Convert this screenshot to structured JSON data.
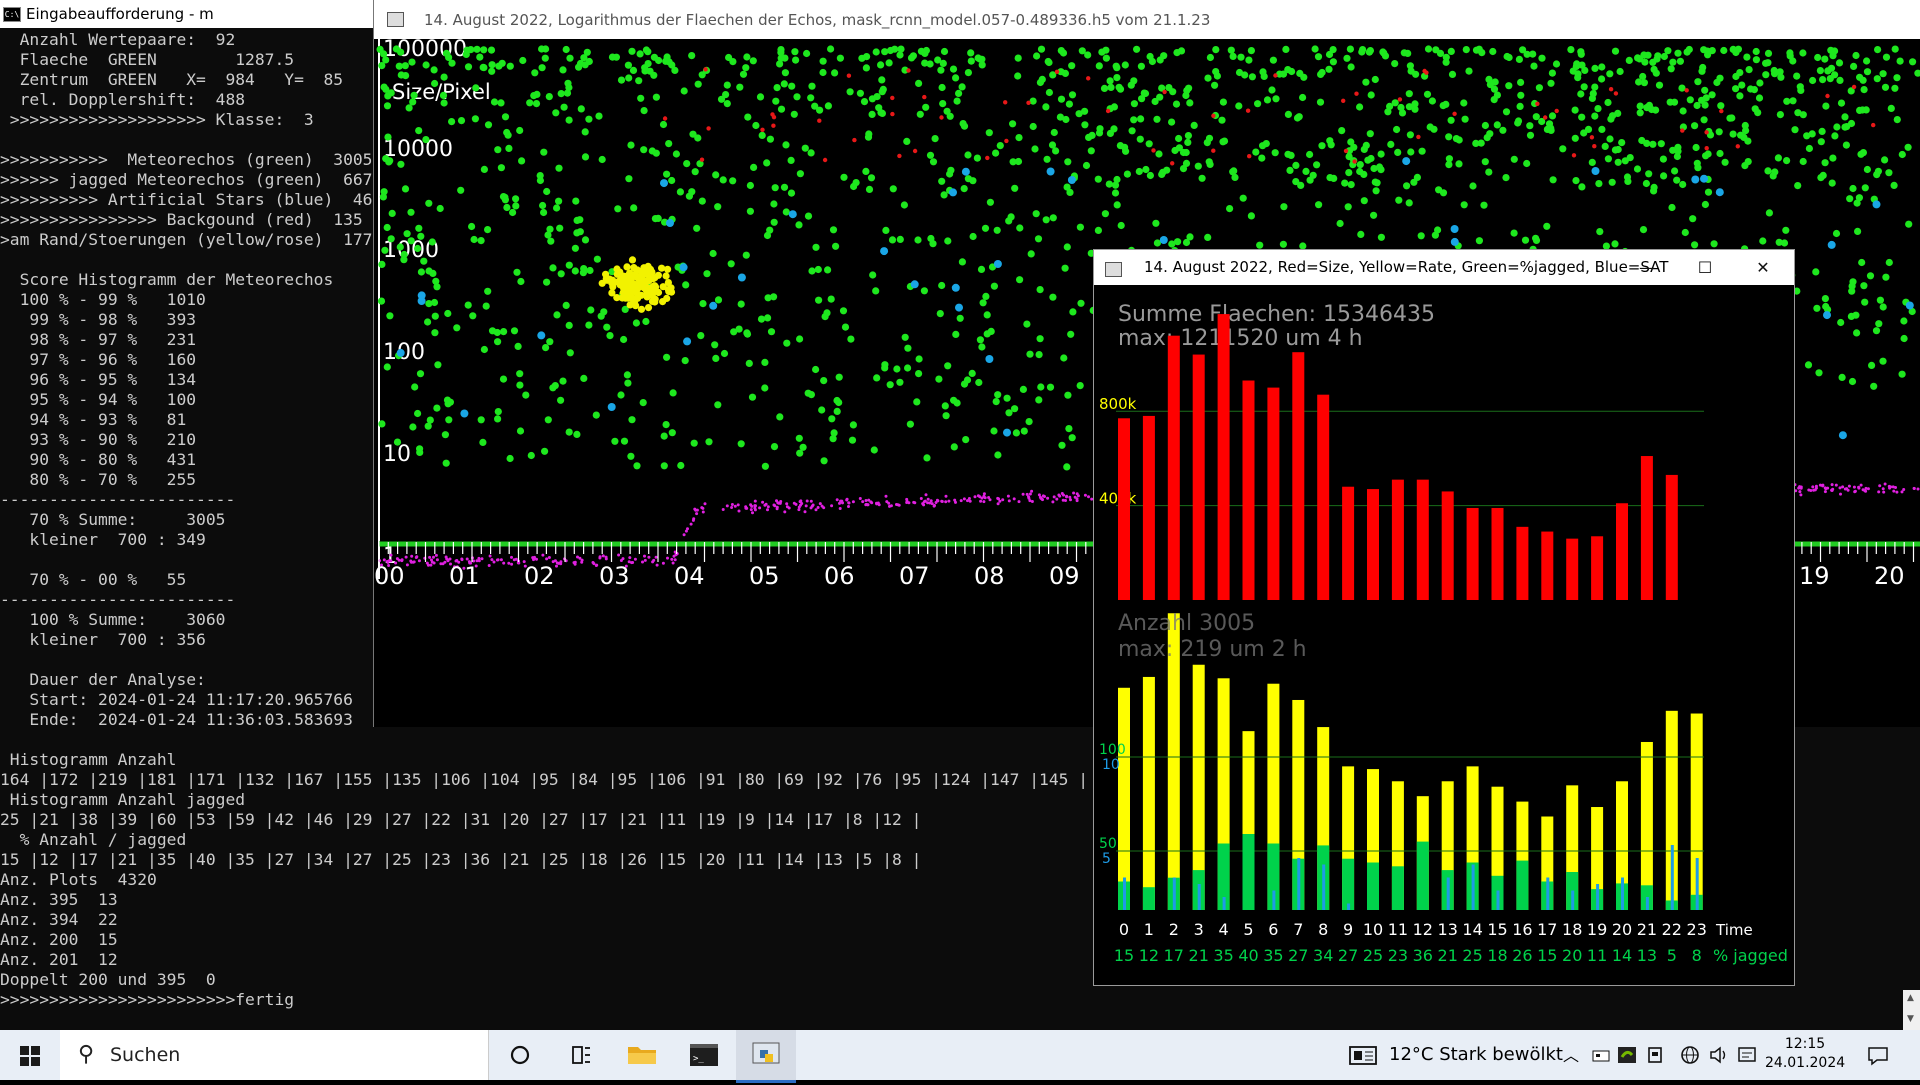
{
  "console": {
    "title": "Eingabeaufforderung - m",
    "lines": [
      "  Anzahl Wertepaare:  92",
      "  Flaeche  GREEN        1287.5",
      "  Zentrum  GREEN   X=  984   Y=  85",
      "  rel. Dopplershift:  488",
      " >>>>>>>>>>>>>>>>>>>> Klasse:  3",
      "",
      ">>>>>>>>>>>  Meteorechos (green)  3005",
      ">>>>>> jagged Meteorechos (green)  667",
      ">>>>>>>>>> Artificial Stars (blue)  46",
      ">>>>>>>>>>>>>>>> Backgound (red)  135",
      ">am Rand/Stoerungen (yellow/rose)  177",
      "",
      "  Score Histogramm der Meteorechos",
      "  100 % - 99 %   1010",
      "   99 % - 98 %   393",
      "   98 % - 97 %   231",
      "   97 % - 96 %   160",
      "   96 % - 95 %   134",
      "   95 % - 94 %   100",
      "   94 % - 93 %   81",
      "   93 % - 90 %   210",
      "   90 % - 80 %   431",
      "   80 % - 70 %   255",
      "------------------------",
      "   70 % Summe:     3005",
      "   kleiner  700 : 349",
      "",
      "   70 % - 00 %   55",
      "------------------------",
      "   100 % Summe:    3060",
      "   kleiner  700 : 356",
      "",
      "   Dauer der Analyse:",
      "   Start: 2024-01-24 11:17:20.965766",
      "   Ende:  2024-01-24 11:36:03.583693",
      "",
      " Histogramm Anzahl",
      "164 |172 |219 |181 |171 |132 |167 |155 |135 |106 |104 |95 |84 |95 |106 |91 |80 |69 |92 |76 |95 |124 |147 |145 |",
      " Histogramm Anzahl jagged",
      "25 |21 |38 |39 |60 |53 |59 |42 |46 |29 |27 |22 |31 |20 |27 |17 |21 |11 |19 |9 |14 |17 |8 |12 |",
      "  % Anzahl / jagged",
      "15 |12 |17 |21 |35 |40 |35 |27 |34 |27 |25 |23 |36 |21 |25 |18 |26 |15 |20 |11 |14 |13 |5 |8 |",
      "Anz. Plots  4320",
      "Anz. 395  13",
      "Anz. 394  22",
      "Anz. 200  15",
      "Anz. 201  12",
      "Doppelt 200 und 395  0",
      ">>>>>>>>>>>>>>>>>>>>>>>>fertig"
    ]
  },
  "plot1": {
    "title": "14. August 2022, Logarithmus der Flaechen der Echos, mask_rcnn_model.057-0.489336.h5 vom 21.1.23",
    "axis_label": "Size/Pixel",
    "y_ticks": [
      "100000",
      "10000",
      "1000",
      "100",
      "10",
      "1"
    ],
    "x_ticks": [
      "00",
      "01",
      "02",
      "03",
      "04",
      "05",
      "06",
      "07",
      "08",
      "09",
      "19",
      "20"
    ],
    "colors": {
      "green": "#1ee81e",
      "yellow": "#f2f200",
      "blue": "#1aa6e6",
      "red": "#e81818",
      "magenta": "#e020e0"
    }
  },
  "plot2": {
    "title": "14. August 2022, Red=Size, Yellow=Rate, Green=%jagged, Blue=SAT",
    "buttons": {
      "minimize": "—",
      "maximize": "☐",
      "close": "✕"
    },
    "summe_label": "Summe  Flaechen:  15346435",
    "max_label": "max:  1211520  um  4  h",
    "anzahl_label": "Anzahl  3005",
    "anzahl_max_label": "max:  219  um  2  h",
    "gridlabels": {
      "k800": "800k",
      "k400": "400k",
      "c100": "100",
      "c10": "10",
      "c50": "50",
      "c5": "5"
    },
    "time_label": "Time",
    "jagged_label": "%  jagged",
    "colors": {
      "red": "#ff0000",
      "yellow": "#ffff00",
      "green": "#00d24b",
      "blue": "#1e9be6",
      "grid": "#1a6e1a"
    }
  },
  "chart_data": {
    "type": "bar",
    "categories": [
      "0",
      "1",
      "2",
      "3",
      "4",
      "5",
      "6",
      "7",
      "8",
      "9",
      "10",
      "11",
      "12",
      "13",
      "14",
      "15",
      "16",
      "17",
      "18",
      "19",
      "20",
      "21",
      "22",
      "23"
    ],
    "series": [
      {
        "name": "Size",
        "values": [
          770000,
          780000,
          1120000,
          1040000,
          1211520,
          930000,
          900000,
          1050000,
          870000,
          480000,
          470000,
          510000,
          510000,
          460000,
          390000,
          390000,
          310000,
          290000,
          260000,
          270000,
          410000,
          610000,
          530000,
          0
        ]
      },
      {
        "name": "Rate",
        "values": [
          164,
          172,
          219,
          181,
          171,
          132,
          167,
          155,
          135,
          106,
          104,
          95,
          84,
          95,
          106,
          91,
          80,
          69,
          92,
          76,
          95,
          124,
          147,
          145
        ]
      },
      {
        "name": "%jagged",
        "values": [
          15,
          12,
          17,
          21,
          35,
          40,
          35,
          27,
          34,
          27,
          25,
          23,
          36,
          21,
          25,
          18,
          26,
          15,
          20,
          11,
          14,
          13,
          5,
          8
        ]
      },
      {
        "name": "SAT",
        "values": [
          5,
          0,
          5,
          4,
          2,
          0,
          3,
          8,
          7,
          1,
          0,
          0,
          0,
          5,
          7,
          3,
          0,
          5,
          3,
          4,
          5,
          2,
          10,
          8
        ]
      }
    ]
  },
  "taskbar": {
    "search_label": "Suchen",
    "weather": "12°C  Stark bewölkt",
    "time": "12:15",
    "date": "24.01.2024"
  }
}
